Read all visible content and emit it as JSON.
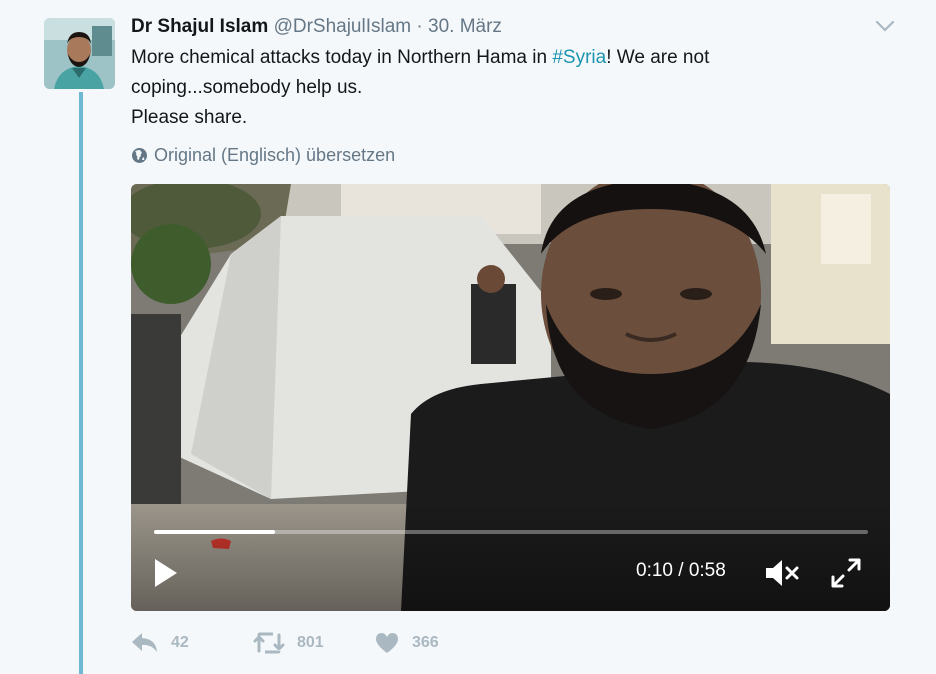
{
  "tweet": {
    "author_name": "Dr Shajul Islam",
    "handle": "@DrShajulIslam",
    "separator": "·",
    "date": "30. März",
    "text_part1": "More chemical attacks today in Northern Hama in ",
    "hashtag": "#Syria",
    "text_part2": "! We are not coping...somebody help us.",
    "text_line3": "Please share.",
    "translate_label": "Original (Englisch) übersetzen"
  },
  "video": {
    "current_time": "0:10",
    "duration": "0:58",
    "time_display": "0:10 / 0:58",
    "progress_fraction": 0.17,
    "muted": true,
    "state": "paused"
  },
  "actions": {
    "replies": "42",
    "retweets": "801",
    "likes": "366"
  },
  "colors": {
    "background": "#f5f8fa",
    "thread_line": "#6fb8d4",
    "link": "#1b95b0",
    "muted_text": "#657786",
    "icon": "#aab8c2"
  }
}
